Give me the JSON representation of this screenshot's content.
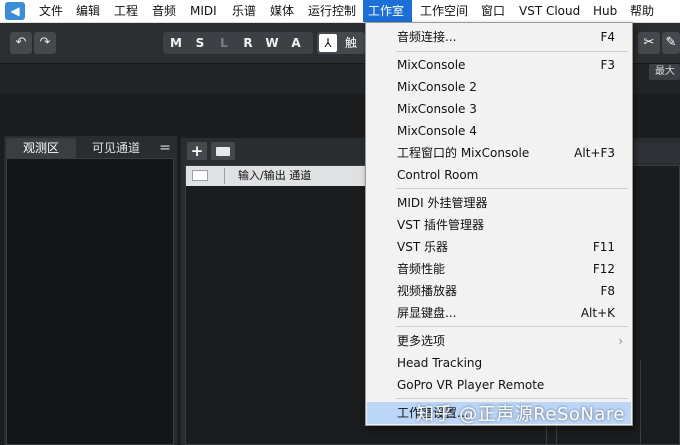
{
  "menubar": {
    "items": [
      "文件",
      "编辑",
      "工程",
      "音频",
      "MIDI",
      "乐谱",
      "媒体",
      "运行控制",
      "工作室",
      "工作空间",
      "窗口",
      "VST Cloud",
      "Hub",
      "帮助"
    ],
    "active_index": 8
  },
  "toolbar": {
    "modes": [
      "M",
      "S",
      "L",
      "R",
      "W",
      "A"
    ],
    "tool_label": "触"
  },
  "max_label": "最大",
  "left_panel": {
    "tab_active": "观测区",
    "tab_inactive": "可见通道",
    "tab_menu": "="
  },
  "track_list": {
    "track_name": "输入/输出 通道"
  },
  "studio_menu": {
    "items": [
      {
        "label": "音频连接...",
        "shortcut": "F4"
      },
      {
        "label": "MixConsole",
        "shortcut": "F3"
      },
      {
        "label": "MixConsole 2",
        "shortcut": ""
      },
      {
        "label": "MixConsole 3",
        "shortcut": ""
      },
      {
        "label": "MixConsole 4",
        "shortcut": ""
      },
      {
        "label": "工程窗口的 MixConsole",
        "shortcut": "Alt+F3"
      },
      {
        "label": "Control Room",
        "shortcut": ""
      },
      {
        "label": "MIDI 外挂管理器",
        "shortcut": ""
      },
      {
        "label": "VST 插件管理器",
        "shortcut": ""
      },
      {
        "label": "VST 乐器",
        "shortcut": "F11"
      },
      {
        "label": "音频性能",
        "shortcut": "F12"
      },
      {
        "label": "视频播放器",
        "shortcut": "F8"
      },
      {
        "label": "屏显键盘...",
        "shortcut": "Alt+K"
      },
      {
        "label": "更多选项",
        "shortcut": ""
      },
      {
        "label": "Head Tracking",
        "shortcut": ""
      },
      {
        "label": "GoPro VR Player Remote",
        "shortcut": ""
      },
      {
        "label": "工作室设置...",
        "shortcut": ""
      }
    ],
    "highlighted_index": 16
  },
  "watermark": "知乎 @正声源ReSoNare",
  "colors": {
    "menu_active": "#1c6fd6",
    "menu_highlight": "#bcd6f7",
    "dark_bg": "#1b1d1f"
  }
}
